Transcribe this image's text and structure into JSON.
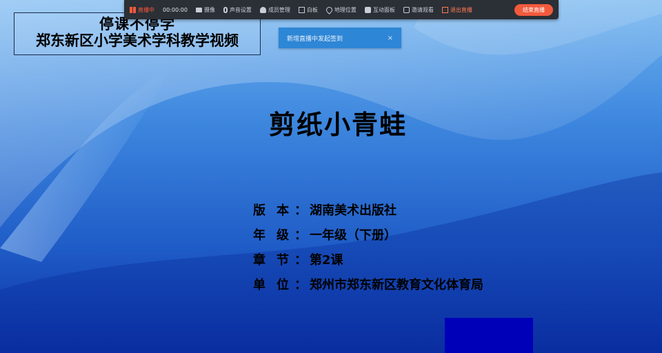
{
  "watermark": {
    "line1": "停课不停学",
    "line2": "郑东新区小学美术学科教学视频"
  },
  "toolbar": {
    "live_status": "直播中",
    "timer": "00:00:00",
    "camera": "摄像",
    "mic": "声音设置",
    "members": "成员管理",
    "whiteboard": "白板",
    "location": "地理位置",
    "chat": "互动面板",
    "share": "邀请观看",
    "exit": "退出直播",
    "end_button": "结束直播",
    "colors": {
      "bg": "#2b2f36",
      "live": "#ff5a3c",
      "end": "#f25a3c"
    }
  },
  "notice": {
    "text": "新增直播中发起签到",
    "close": "×"
  },
  "slide": {
    "title": "剪纸小青蛙",
    "rows": [
      {
        "k1": "版",
        "k2": "本",
        "value": "湖南美术出版社"
      },
      {
        "k1": "年",
        "k2": "级",
        "value": "一年级（下册）"
      },
      {
        "k1": "章",
        "k2": "节",
        "value": "第2课"
      },
      {
        "k1": "单",
        "k2": "位",
        "value": "郑州市郑东新区教育文化体育局"
      }
    ],
    "separator": "："
  }
}
